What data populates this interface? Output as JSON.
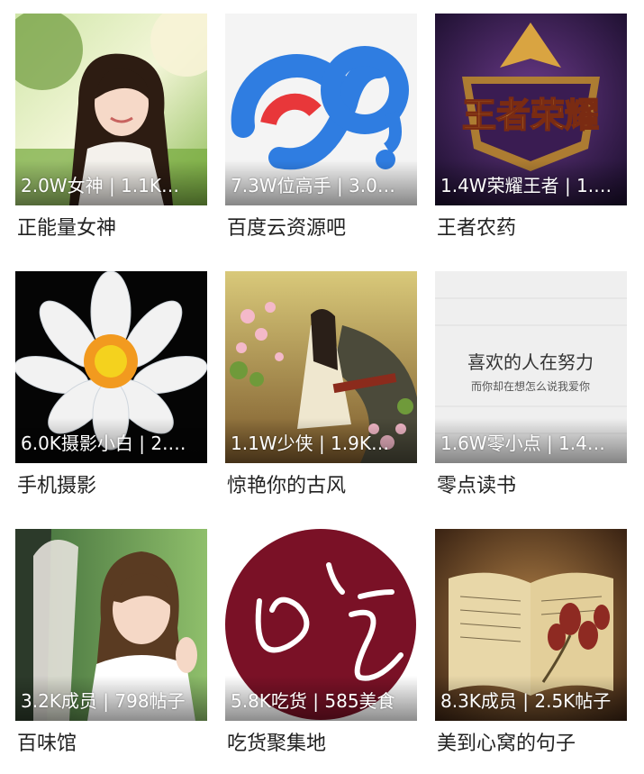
{
  "groups": [
    {
      "name": "正能量女神",
      "stats": "2.0W女神 | 1.1K…"
    },
    {
      "name": "百度云资源吧",
      "stats": "7.3W位高手 | 3.0…"
    },
    {
      "name": "王者农药",
      "stats": "1.4W荣耀王者 | 1.…",
      "image_text": "王者荣耀"
    },
    {
      "name": "手机摄影",
      "stats": "6.0K摄影小白 | 2.…"
    },
    {
      "name": "惊艳你的古风",
      "stats": "1.1W少侠 | 1.9K…"
    },
    {
      "name": "零点读书",
      "stats": "1.6W零小点 | 1.4…",
      "image_text": [
        "喜欢的人在努力",
        "而你却在想怎么说我爱你"
      ]
    },
    {
      "name": "百味馆",
      "stats": "3.2K成员 | 798帖子"
    },
    {
      "name": "吃货聚集地",
      "stats": "5.8K吃货 | 585美食"
    },
    {
      "name": "美到心窝的句子",
      "stats": "8.3K成员 | 2.5K帖子"
    }
  ],
  "icons": [
    "portrait-photo",
    "baidu-cloud-logo",
    "king-of-glory-logo",
    "lotus-photo",
    "ancient-style-illustration",
    "quote-card",
    "couple-photo",
    "foodie-logo",
    "open-book-roses-photo"
  ]
}
